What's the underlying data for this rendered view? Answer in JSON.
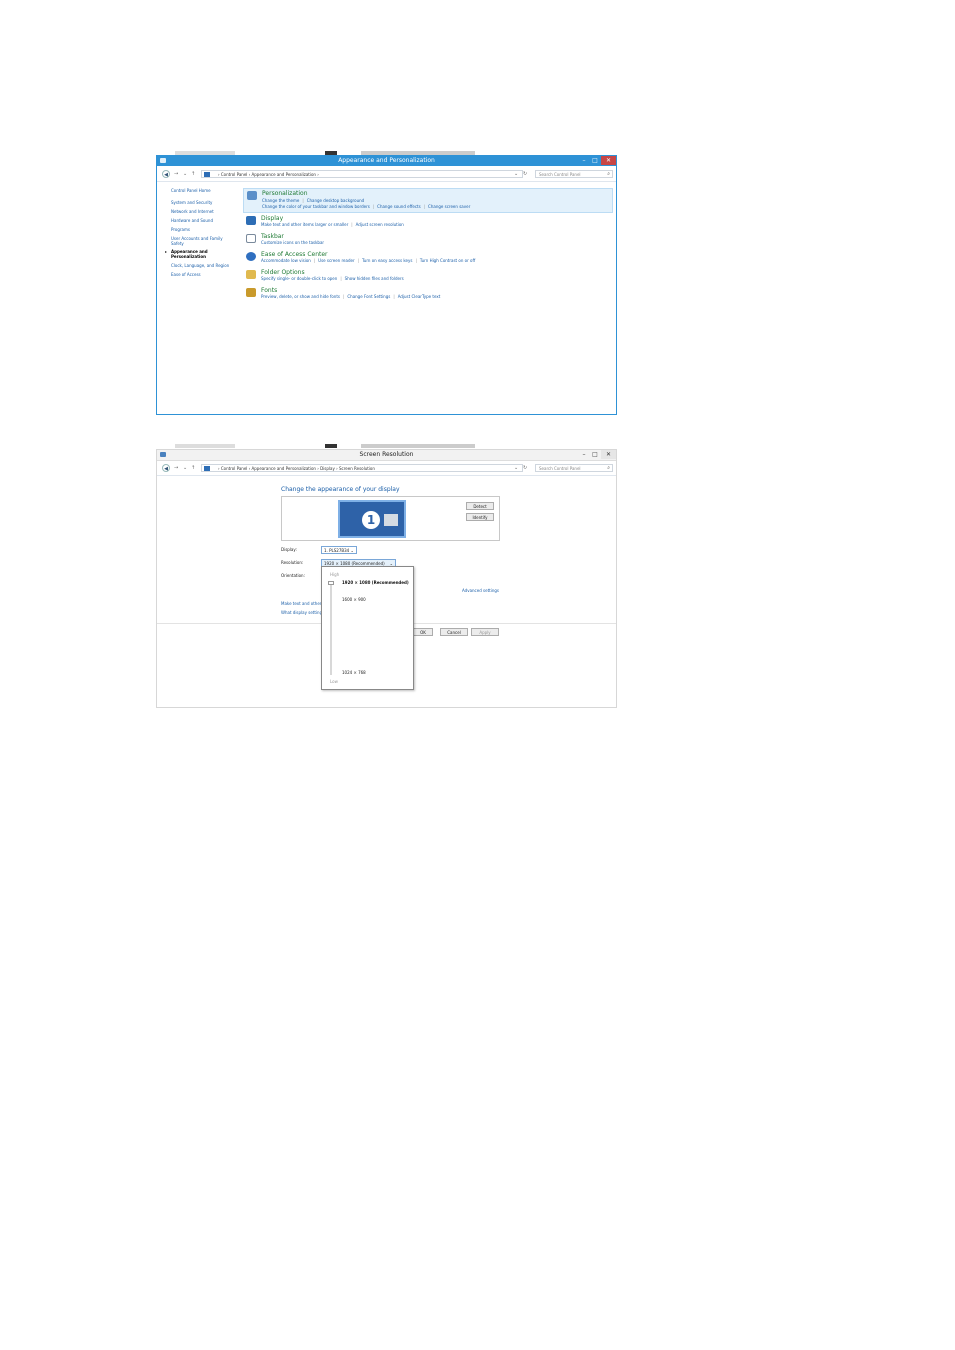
{
  "win1": {
    "title": "Appearance and Personalization",
    "min": "–",
    "max": "□",
    "close": "✕",
    "path": "› Control Panel › Appearance and Personalization ›",
    "search": "Search Control Panel",
    "sidebar": [
      "Control Panel Home",
      "System and Security",
      "Network and Internet",
      "Hardware and Sound",
      "Programs",
      "User Accounts and Family",
      "Safety",
      "Appearance and",
      "Personalization",
      "Clock, Language, and Region",
      "Ease of Access"
    ],
    "categories": [
      {
        "title": "Personalization",
        "icon_color": "#5a8fc9",
        "lines": [
          [
            "Change the theme",
            "Change desktop background"
          ],
          [
            "Change the color of your taskbar and window borders",
            "Change sound effects",
            "Change screen saver"
          ]
        ]
      },
      {
        "title": "Display",
        "icon_color": "#2d6db5",
        "lines": [
          [
            "Make text and other items larger or smaller",
            "Adjust screen resolution"
          ]
        ]
      },
      {
        "title": "Taskbar",
        "icon_color": "#7a8a9c",
        "lines": [
          [
            "Customize icons on the taskbar"
          ]
        ]
      },
      {
        "title": "Ease of Access Center",
        "icon_color": "#2f6fc0",
        "lines": [
          [
            "Accommodate low vision",
            "Use screen reader",
            "Turn on easy access keys",
            "Turn High Contrast on or off"
          ]
        ]
      },
      {
        "title": "Folder Options",
        "icon_color": "#e0b94f",
        "lines": [
          [
            "Specify single- or double-click to open",
            "Show hidden files and folders"
          ]
        ]
      },
      {
        "title": "Fonts",
        "icon_color": "#c99a2b",
        "lines": [
          [
            "Preview, delete, or show and hide fonts",
            "Change Font Settings",
            "Adjust ClearType text"
          ]
        ]
      }
    ]
  },
  "win2": {
    "title": "Screen Resolution",
    "min": "–",
    "max": "□",
    "close": "✕",
    "path": "› Control Panel › Appearance and Personalization › Display › Screen Resolution",
    "search": "Search Control Panel",
    "heading": "Change the appearance of your display",
    "monitor_number": "1",
    "detect": "Detect",
    "identify": "Identify",
    "display_label": "Display:",
    "display_value": "1. PLS27B34 ⌄",
    "resolution_label": "Resolution:",
    "resolution_value": "1920 × 1080 (Recommended)",
    "orientation_label": "Orientation:",
    "advanced": "Advanced settings",
    "link1": "Make text and other",
    "link2": "What display setting",
    "ok": "OK",
    "cancel": "Cancel",
    "apply": "Apply",
    "dropdown": {
      "high": "High",
      "low": "Low",
      "options": [
        "1920 × 1080 (Recommended)",
        "1600 × 900",
        "1024 × 768"
      ]
    }
  },
  "accent": "#2e92d6",
  "link_color": "#1a5ea8",
  "title_green": "#1f7a34"
}
